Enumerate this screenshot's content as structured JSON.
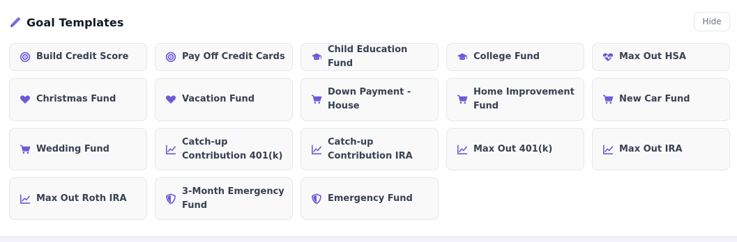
{
  "colors": {
    "accent": "#6d5ad9",
    "card_bg": "#f9f9fa",
    "border": "#e5e7eb",
    "title": "#111827"
  },
  "header": {
    "title": "Goal Templates",
    "icon": "pencil-icon",
    "hide_label": "Hide"
  },
  "templates": [
    {
      "label": "Build Credit Score",
      "icon": "target"
    },
    {
      "label": "Pay Off Credit Cards",
      "icon": "target"
    },
    {
      "label": "Child Education Fund",
      "icon": "graduation-cap"
    },
    {
      "label": "College Fund",
      "icon": "graduation-cap"
    },
    {
      "label": "Max Out HSA",
      "icon": "heart-pulse"
    },
    {
      "label": "Christmas Fund",
      "icon": "heart"
    },
    {
      "label": "Vacation Fund",
      "icon": "heart"
    },
    {
      "label": "Down Payment - House",
      "icon": "cart"
    },
    {
      "label": "Home Improvement Fund",
      "icon": "cart"
    },
    {
      "label": "New Car Fund",
      "icon": "cart"
    },
    {
      "label": "Wedding Fund",
      "icon": "cart"
    },
    {
      "label": "Catch-up Contribution 401(k)",
      "icon": "chart"
    },
    {
      "label": "Catch-up Contribution IRA",
      "icon": "chart"
    },
    {
      "label": "Max Out 401(k)",
      "icon": "chart"
    },
    {
      "label": "Max Out IRA",
      "icon": "chart"
    },
    {
      "label": "Max Out Roth IRA",
      "icon": "chart"
    },
    {
      "label": "3-Month Emergency Fund",
      "icon": "shield"
    },
    {
      "label": "Emergency Fund",
      "icon": "shield"
    }
  ]
}
